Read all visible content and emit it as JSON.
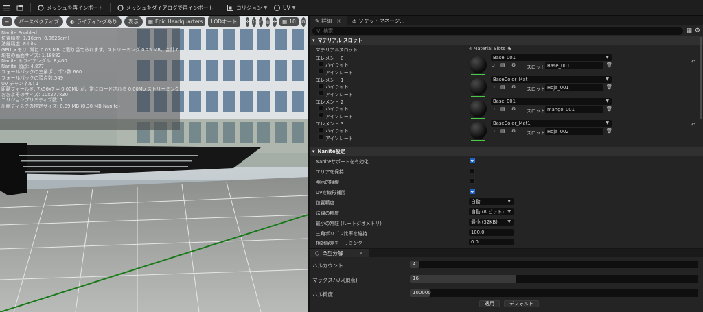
{
  "toolbar": {
    "items": [
      {
        "icon": "hamburger-icon",
        "label": ""
      },
      {
        "icon": "camera-icon",
        "label": ""
      },
      {
        "icon": "reimport-icon",
        "label": "メッシュを再インポート"
      },
      {
        "icon": "reimport-dialog-icon",
        "label": "メッシュをダイアログで再インポート"
      },
      {
        "icon": "collision-icon",
        "label": "コリジョン"
      },
      {
        "icon": "uv-icon",
        "label": "UV"
      }
    ]
  },
  "viewport": {
    "menu_icon": "≡",
    "perspective": "パースペクティブ",
    "lighting": "ライティングあり",
    "show": "表示",
    "preview": "Epic Headquarters",
    "lod": "LODオート",
    "grid_value": "10",
    "stats": [
      "Nanite Enabled",
      "位置精度: 1/16cm (0.0625cm)",
      "法線精度: 8 bits",
      "GPU メモリ: 常に 0.03 MB に割り当てられます。ストリーミング 0.25 MB。合計 0.28 MB",
      "現在の画面サイズ: 1.18882",
      "Nanite トライアングル: 8,460",
      "Nanite 頂点: 4,877",
      "フォールバックの三角ポリゴン数:660",
      "フォールバックの頂点数:549",
      "UV チャンネル: 1",
      "距離フィールド: 7x56x7 = 0.00Mb が、常にロードされる 0.00Mb ストリーミングされる",
      "おおよそのサイズ: 10x277x30",
      "コリジョンプリミティブ数: 1",
      "圧縮ディスクの推定サイズ: 0.09 MB (0.30 MB Nanite)"
    ]
  },
  "details": {
    "tabs": [
      {
        "label": "詳細"
      },
      {
        "label": "ソケットマネージ..."
      }
    ],
    "search_placeholder": "検索",
    "material_section": "マテリアル スロット",
    "material_slots_label": "マテリアルスロット",
    "material_slots_count": "4 Material Slots",
    "highlight": "ハイライト",
    "isolate": "アイソレート",
    "slot_label": "スロット",
    "elements": [
      {
        "name": "エレメント 0",
        "material": "Base_001",
        "slot": "Base_001"
      },
      {
        "name": "エレメント 1",
        "material": "BaseColor_Mat",
        "slot": "Hoja_001"
      },
      {
        "name": "エレメント 2",
        "material": "Base_001",
        "slot": "mango_001"
      },
      {
        "name": "エレメント 3",
        "material": "BaseColor_Mat1",
        "slot": "Hoja_002"
      }
    ],
    "nanite_section": "Nanite設定",
    "nanite": [
      {
        "label": "Naniteサポートを有効化",
        "type": "check",
        "checked": true
      },
      {
        "label": "エリアを保持",
        "type": "check",
        "checked": false
      },
      {
        "label": "明示的接線",
        "type": "check",
        "checked": false
      },
      {
        "label": "UVを線形補間",
        "type": "check",
        "checked": true
      },
      {
        "label": "位置精度",
        "type": "combo",
        "value": "自動"
      },
      {
        "label": "法線の精度",
        "type": "combo",
        "value": "自動 (8 ビット)"
      },
      {
        "label": "最小の常駐 (ルートジオメトリ)",
        "type": "combo",
        "value": "最小 (32KB)"
      },
      {
        "label": "三角ポリゴン比率を維持",
        "type": "field",
        "value": "100.0"
      },
      {
        "label": "相対誤差をトリミング",
        "type": "field",
        "value": "0.0"
      }
    ]
  },
  "convex": {
    "title": "凸型分解",
    "rows": [
      {
        "label": "ハルカウント",
        "value": "4",
        "fill": 0.03
      },
      {
        "label": "マックスハル(頂点)",
        "value": "16",
        "fill": 0.37
      },
      {
        "label": "ハル精度",
        "value": "100000",
        "fill": 0.07
      }
    ],
    "apply": "適用",
    "default": "デフォルト"
  }
}
